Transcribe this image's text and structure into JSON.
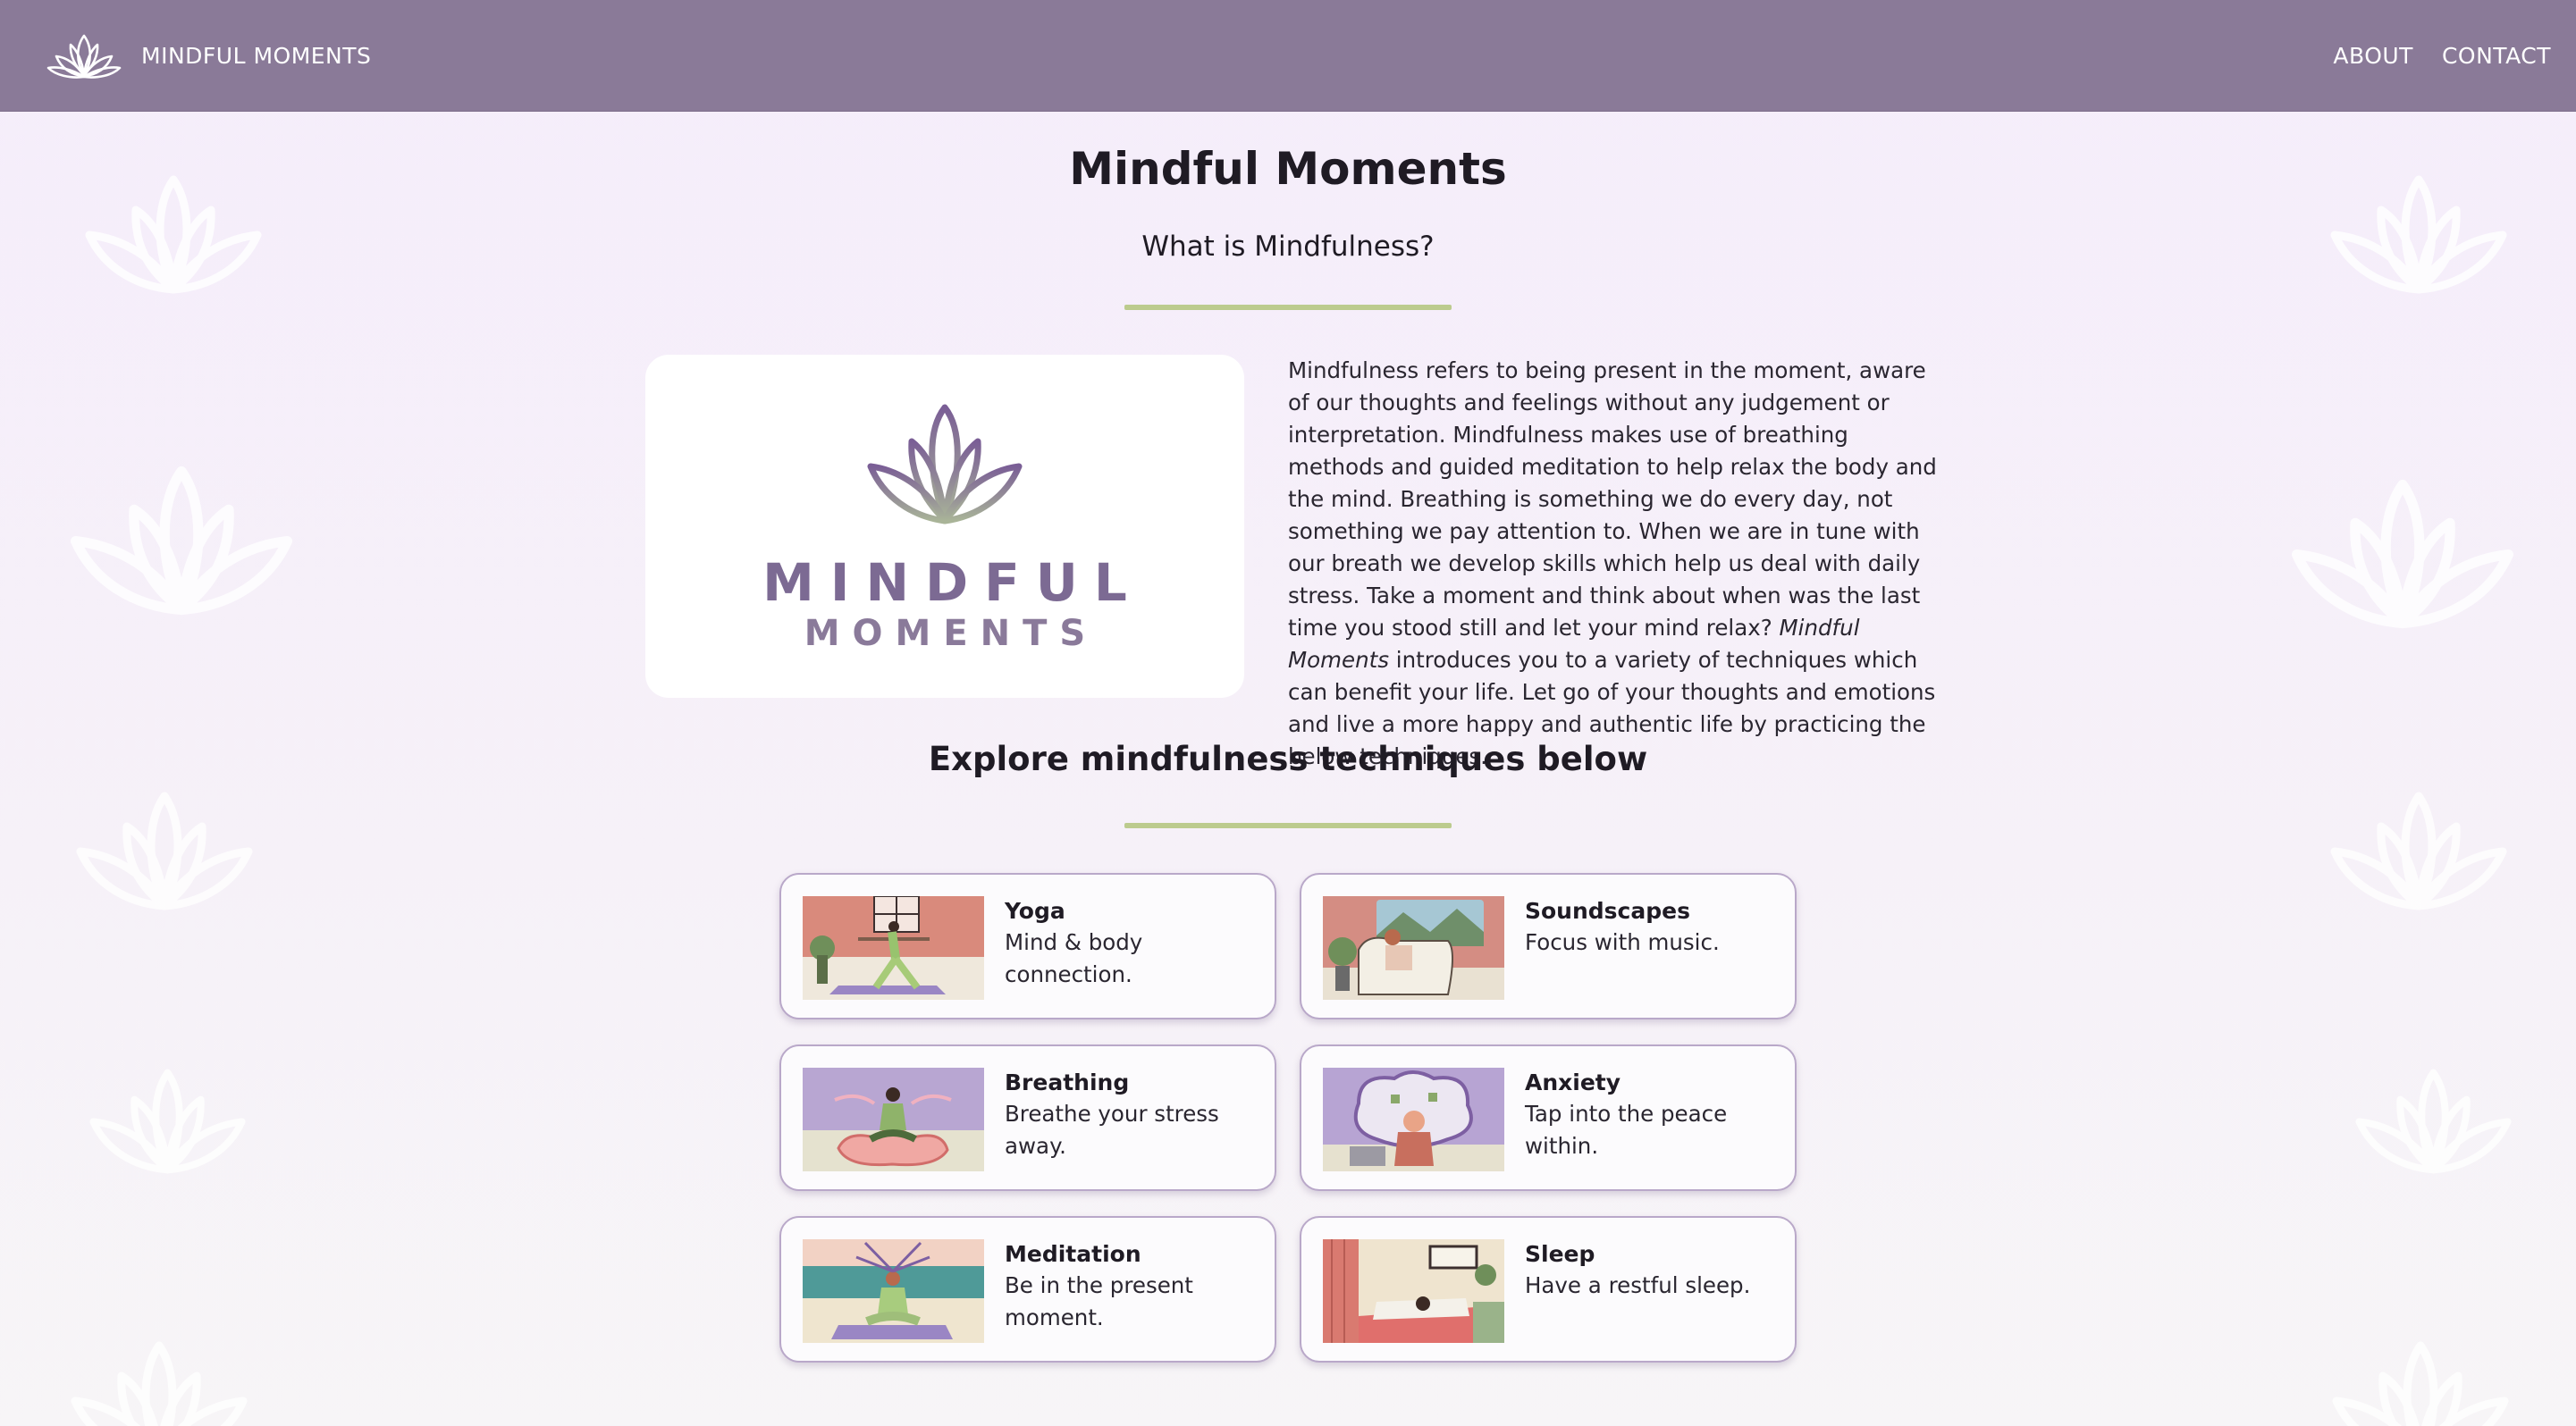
{
  "header": {
    "brand_name": "MINDFUL MOMENTS",
    "nav": [
      {
        "label": "ABOUT"
      },
      {
        "label": "CONTACT"
      }
    ],
    "background_color": "#8a7a98"
  },
  "hero": {
    "title": "Mindful Moments",
    "subtitle": "What is Mindfulness?",
    "logo_word1": "MINDFUL",
    "logo_word2": "MOMENTS",
    "intro_part1": "Mindfulness refers to being present in the moment, aware of our thoughts and feelings without any judgement or interpretation. Mindfulness makes use of breathing methods and guided meditation to help relax the body and the mind. Breathing is something we do every day, not something we pay attention to. When we are in tune with our breath we develop skills which help us deal with daily stress. Take a moment and think about when was the last time you stood still and let your mind relax? ",
    "intro_italic": "Mindful Moments",
    "intro_part2": " introduces you to a variety of techniques which can benefit your life. Let go of your thoughts and emotions and live a more happy and authentic life by practicing the below techniques."
  },
  "techniques": {
    "section_title": "Explore mindfulness techniques below",
    "cards": [
      {
        "title": "Yoga",
        "description": "Mind & body connection.",
        "icon": "yoga-illustration"
      },
      {
        "title": "Soundscapes",
        "description": "Focus with music.",
        "icon": "soundscapes-illustration"
      },
      {
        "title": "Breathing",
        "description": "Breathe your stress away.",
        "icon": "breathing-illustration"
      },
      {
        "title": "Anxiety",
        "description": "Tap into the peace within.",
        "icon": "anxiety-illustration"
      },
      {
        "title": "Meditation",
        "description": "Be in the present moment.",
        "icon": "meditation-illustration"
      },
      {
        "title": "Sleep",
        "description": "Have a restful sleep.",
        "icon": "sleep-illustration"
      }
    ]
  },
  "colors": {
    "accent_divider": "#bccb8e",
    "logo_purple": "#7c6a93",
    "page_background": "#f5edfb"
  }
}
